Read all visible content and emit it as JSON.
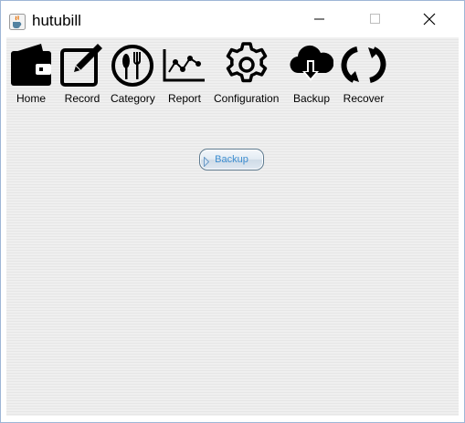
{
  "window": {
    "title": "hutubill",
    "controls": {
      "minimize_icon": "minimize-icon",
      "maximize_icon": "maximize-icon",
      "close_icon": "close-icon"
    }
  },
  "toolbar": {
    "items": [
      {
        "label": "Home",
        "icon": "wallet-icon"
      },
      {
        "label": "Record",
        "icon": "edit-icon"
      },
      {
        "label": "Category",
        "icon": "cutlery-icon"
      },
      {
        "label": "Report",
        "icon": "line-chart-icon"
      },
      {
        "label": "Configuration",
        "icon": "gear-icon"
      },
      {
        "label": "Backup",
        "icon": "cloud-download-icon"
      },
      {
        "label": "Recover",
        "icon": "refresh-icon"
      }
    ]
  },
  "main": {
    "backup_button_label": "Backup"
  },
  "colors": {
    "window_border": "#9eb6d6",
    "button_text": "#3e8ed0",
    "panel_background": "#ededed"
  }
}
